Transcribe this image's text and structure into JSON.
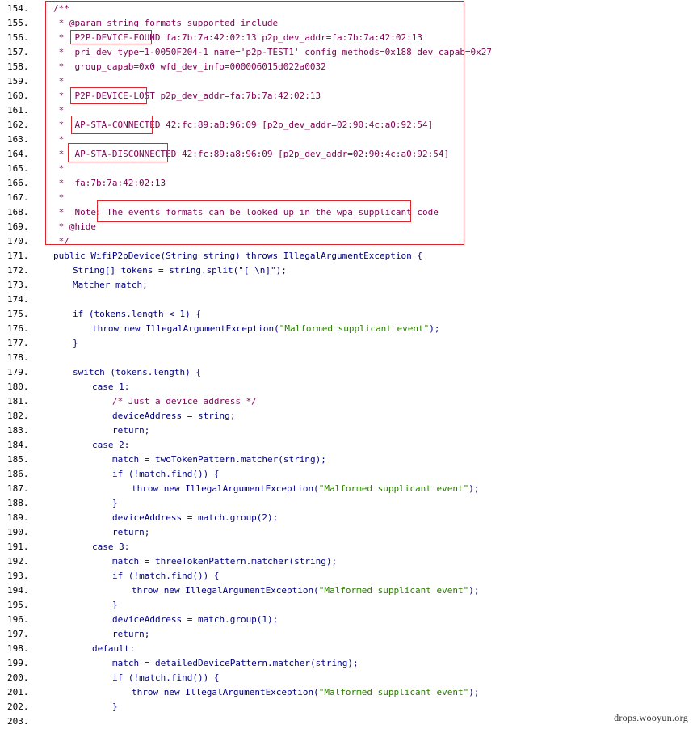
{
  "lines": [
    {
      "num": "154.",
      "parts": [
        {
          "t": "/**",
          "c": "cm"
        }
      ]
    },
    {
      "num": "155.",
      "parts": [
        {
          "t": " * @param string formats supported include",
          "c": "cm"
        }
      ]
    },
    {
      "num": "156.",
      "parts": [
        {
          "t": " *  ",
          "c": "cm"
        },
        {
          "t": "P2P-DEVICE-FOUND",
          "c": "cm"
        },
        {
          "t": " fa:7b:7a:42:02:13 p2p_dev_addr=fa:7b:7a:42:02:13",
          "c": "cm"
        }
      ]
    },
    {
      "num": "157.",
      "parts": [
        {
          "t": " *  pri_dev_type=1-0050F204-1 name='p2p-TEST1' config_methods=0x188 dev_capab=0x27",
          "c": "cm"
        }
      ]
    },
    {
      "num": "158.",
      "parts": [
        {
          "t": " *  group_capab=0x0 wfd_dev_info=000006015d022a0032",
          "c": "cm"
        }
      ]
    },
    {
      "num": "159.",
      "parts": [
        {
          "t": " *",
          "c": "cm"
        }
      ]
    },
    {
      "num": "160.",
      "parts": [
        {
          "t": " *  ",
          "c": "cm"
        },
        {
          "t": "P2P-DEVICE-LOST",
          "c": "cm"
        },
        {
          "t": " p2p_dev_addr=fa:7b:7a:42:02:13",
          "c": "cm"
        }
      ]
    },
    {
      "num": "161.",
      "parts": [
        {
          "t": " *",
          "c": "cm"
        }
      ]
    },
    {
      "num": "162.",
      "parts": [
        {
          "t": " *  ",
          "c": "cm"
        },
        {
          "t": "AP-STA-CONNECTED",
          "c": "cm"
        },
        {
          "t": " 42:fc:89:a8:96:09 [p2p_dev_addr=02:90:4c:a0:92:54]",
          "c": "cm"
        }
      ]
    },
    {
      "num": "163.",
      "parts": [
        {
          "t": " *",
          "c": "cm"
        }
      ]
    },
    {
      "num": "164.",
      "parts": [
        {
          "t": " *  ",
          "c": "cm"
        },
        {
          "t": "AP-STA-DISCONNECTED",
          "c": "cm"
        },
        {
          "t": " 42:fc:89:a8:96:09 [p2p_dev_addr=02:90:4c:a0:92:54]",
          "c": "cm"
        }
      ]
    },
    {
      "num": "165.",
      "parts": [
        {
          "t": " *",
          "c": "cm"
        }
      ]
    },
    {
      "num": "166.",
      "parts": [
        {
          "t": " *  fa:7b:7a:42:02:13",
          "c": "cm"
        }
      ]
    },
    {
      "num": "167.",
      "parts": [
        {
          "t": " *",
          "c": "cm"
        }
      ]
    },
    {
      "num": "168.",
      "parts": [
        {
          "t": " *  Note: ",
          "c": "cm"
        },
        {
          "t": "The events formats can be looked up in the wpa_supplicant code",
          "c": "cm"
        }
      ]
    },
    {
      "num": "169.",
      "parts": [
        {
          "t": " * @hide",
          "c": "cm"
        }
      ]
    },
    {
      "num": "170.",
      "parts": [
        {
          "t": " */",
          "c": "cm"
        }
      ]
    },
    {
      "num": "171.",
      "parts": [
        {
          "t": "public WifiP2pDevice(String string) throws IllegalArgumentException {",
          "c": "kw"
        }
      ]
    },
    {
      "num": "172.",
      "indent": 1,
      "parts": [
        {
          "t": "String[] tokens = string.split(\"[ \\n]\");",
          "c": "kw"
        }
      ]
    },
    {
      "num": "173.",
      "indent": 1,
      "parts": [
        {
          "t": "Matcher match;",
          "c": "kw"
        }
      ]
    },
    {
      "num": "174.",
      "parts": []
    },
    {
      "num": "175.",
      "indent": 1,
      "parts": [
        {
          "t": "if (tokens.length < 1) {",
          "c": "kw"
        }
      ]
    },
    {
      "num": "176.",
      "indent": 2,
      "parts": [
        {
          "t": "throw new IllegalArgumentException(",
          "c": "kw"
        },
        {
          "t": "\"Malformed supplicant event\"",
          "c": "str"
        },
        {
          "t": ");",
          "c": "kw"
        }
      ]
    },
    {
      "num": "177.",
      "indent": 1,
      "parts": [
        {
          "t": "}",
          "c": "kw"
        }
      ]
    },
    {
      "num": "178.",
      "parts": []
    },
    {
      "num": "179.",
      "indent": 1,
      "parts": [
        {
          "t": "switch (tokens.length) {",
          "c": "kw"
        }
      ]
    },
    {
      "num": "180.",
      "indent": 2,
      "parts": [
        {
          "t": "case 1:",
          "c": "kw"
        }
      ]
    },
    {
      "num": "181.",
      "indent": 3,
      "parts": [
        {
          "t": "/* Just a device address */",
          "c": "cmt"
        }
      ]
    },
    {
      "num": "182.",
      "indent": 3,
      "parts": [
        {
          "t": "deviceAddress = string;",
          "c": "kw"
        }
      ]
    },
    {
      "num": "183.",
      "indent": 3,
      "parts": [
        {
          "t": "return;",
          "c": "kw"
        }
      ]
    },
    {
      "num": "184.",
      "indent": 2,
      "parts": [
        {
          "t": "case 2:",
          "c": "kw"
        }
      ]
    },
    {
      "num": "185.",
      "indent": 3,
      "parts": [
        {
          "t": "match = twoTokenPattern.matcher(string);",
          "c": "kw"
        }
      ]
    },
    {
      "num": "186.",
      "indent": 3,
      "parts": [
        {
          "t": "if (!match.find()) {",
          "c": "kw"
        }
      ]
    },
    {
      "num": "187.",
      "indent": 4,
      "parts": [
        {
          "t": "throw new IllegalArgumentException(",
          "c": "kw"
        },
        {
          "t": "\"Malformed supplicant event\"",
          "c": "str"
        },
        {
          "t": ");",
          "c": "kw"
        }
      ]
    },
    {
      "num": "188.",
      "indent": 3,
      "parts": [
        {
          "t": "}",
          "c": "kw"
        }
      ]
    },
    {
      "num": "189.",
      "indent": 3,
      "parts": [
        {
          "t": "deviceAddress = match.group(2);",
          "c": "kw"
        }
      ]
    },
    {
      "num": "190.",
      "indent": 3,
      "parts": [
        {
          "t": "return;",
          "c": "kw"
        }
      ]
    },
    {
      "num": "191.",
      "indent": 2,
      "parts": [
        {
          "t": "case 3:",
          "c": "kw"
        }
      ]
    },
    {
      "num": "192.",
      "indent": 3,
      "parts": [
        {
          "t": "match = threeTokenPattern.matcher(string);",
          "c": "kw"
        }
      ]
    },
    {
      "num": "193.",
      "indent": 3,
      "parts": [
        {
          "t": "if (!match.find()) {",
          "c": "kw"
        }
      ]
    },
    {
      "num": "194.",
      "indent": 4,
      "parts": [
        {
          "t": "throw new IllegalArgumentException(",
          "c": "kw"
        },
        {
          "t": "\"Malformed supplicant event\"",
          "c": "str"
        },
        {
          "t": ");",
          "c": "kw"
        }
      ]
    },
    {
      "num": "195.",
      "indent": 3,
      "parts": [
        {
          "t": "}",
          "c": "kw"
        }
      ]
    },
    {
      "num": "196.",
      "indent": 3,
      "parts": [
        {
          "t": "deviceAddress = match.group(1);",
          "c": "kw"
        }
      ]
    },
    {
      "num": "197.",
      "indent": 3,
      "parts": [
        {
          "t": "return;",
          "c": "kw"
        }
      ]
    },
    {
      "num": "198.",
      "indent": 2,
      "parts": [
        {
          "t": "default:",
          "c": "kw"
        }
      ]
    },
    {
      "num": "199.",
      "indent": 3,
      "parts": [
        {
          "t": "match = detailedDevicePattern.matcher(string);",
          "c": "kw"
        }
      ]
    },
    {
      "num": "200.",
      "indent": 3,
      "parts": [
        {
          "t": "if (!match.find()) {",
          "c": "kw"
        }
      ]
    },
    {
      "num": "201.",
      "indent": 4,
      "parts": [
        {
          "t": "throw new IllegalArgumentException(",
          "c": "kw"
        },
        {
          "t": "\"Malformed supplicant event\"",
          "c": "str"
        },
        {
          "t": ");",
          "c": "kw"
        }
      ]
    },
    {
      "num": "202.",
      "indent": 3,
      "parts": [
        {
          "t": "}",
          "c": "kw"
        }
      ]
    },
    {
      "num": "203.",
      "parts": []
    }
  ],
  "watermark": "drops.wooyun.org",
  "colors": {
    "highlight_border": "#d9262c",
    "keyword": "#000080",
    "comment": "#7f0055",
    "string": "#2a7a00"
  }
}
